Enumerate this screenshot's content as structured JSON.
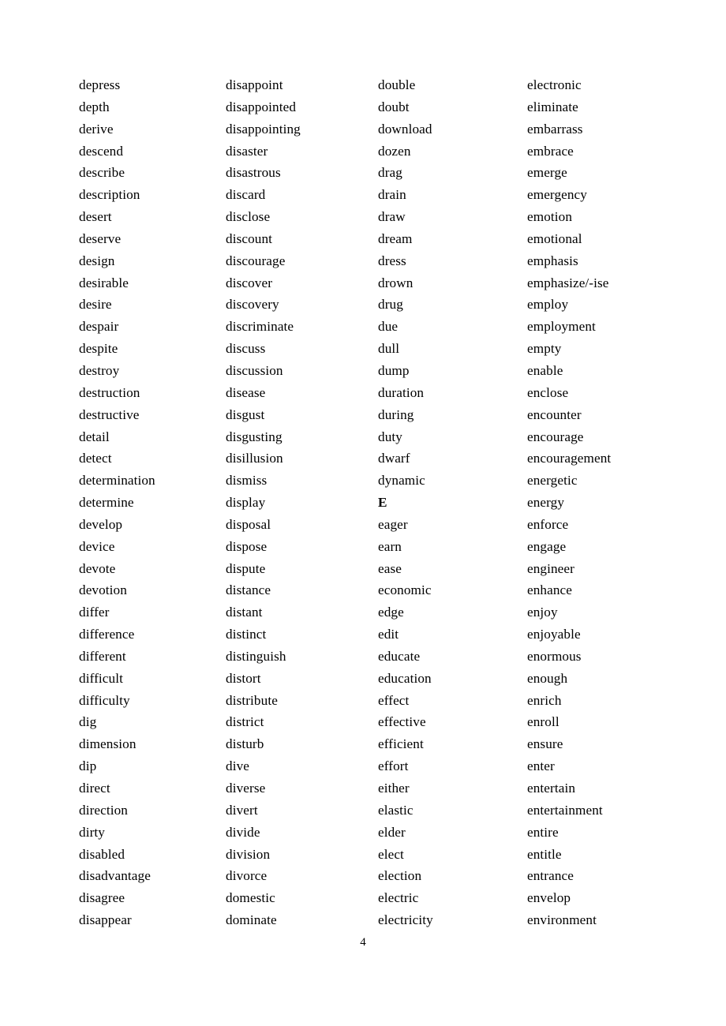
{
  "page": {
    "number": "4",
    "background_color": "#ffffff",
    "text_color": "#000000"
  },
  "columns": [
    {
      "name": "column-1",
      "entries": [
        {
          "text": "depress",
          "bold": false
        },
        {
          "text": "depth",
          "bold": false
        },
        {
          "text": "derive",
          "bold": false
        },
        {
          "text": "descend",
          "bold": false
        },
        {
          "text": "describe",
          "bold": false
        },
        {
          "text": "description",
          "bold": false
        },
        {
          "text": "desert",
          "bold": false
        },
        {
          "text": "deserve",
          "bold": false
        },
        {
          "text": "design",
          "bold": false
        },
        {
          "text": "desirable",
          "bold": false
        },
        {
          "text": "desire",
          "bold": false
        },
        {
          "text": "despair",
          "bold": false
        },
        {
          "text": "despite",
          "bold": false
        },
        {
          "text": "destroy",
          "bold": false
        },
        {
          "text": "destruction",
          "bold": false
        },
        {
          "text": "destructive",
          "bold": false
        },
        {
          "text": "detail",
          "bold": false
        },
        {
          "text": "detect",
          "bold": false
        },
        {
          "text": "determination",
          "bold": false
        },
        {
          "text": "determine",
          "bold": false
        },
        {
          "text": "develop",
          "bold": false
        },
        {
          "text": "device",
          "bold": false
        },
        {
          "text": "devote",
          "bold": false
        },
        {
          "text": "devotion",
          "bold": false
        },
        {
          "text": "differ",
          "bold": false
        },
        {
          "text": "difference",
          "bold": false
        },
        {
          "text": "different",
          "bold": false
        },
        {
          "text": "difficult",
          "bold": false
        },
        {
          "text": "difficulty",
          "bold": false
        },
        {
          "text": "dig",
          "bold": false
        },
        {
          "text": "dimension",
          "bold": false
        },
        {
          "text": "dip",
          "bold": false
        },
        {
          "text": "direct",
          "bold": false
        },
        {
          "text": "direction",
          "bold": false
        },
        {
          "text": "dirty",
          "bold": false
        },
        {
          "text": "disabled",
          "bold": false
        },
        {
          "text": "disadvantage",
          "bold": false
        },
        {
          "text": "disagree",
          "bold": false
        },
        {
          "text": "disappear",
          "bold": false
        }
      ]
    },
    {
      "name": "column-2",
      "entries": [
        {
          "text": "disappoint",
          "bold": false
        },
        {
          "text": "disappointed",
          "bold": false
        },
        {
          "text": "disappointing",
          "bold": false
        },
        {
          "text": "disaster",
          "bold": false
        },
        {
          "text": "disastrous",
          "bold": false
        },
        {
          "text": "discard",
          "bold": false
        },
        {
          "text": "disclose",
          "bold": false
        },
        {
          "text": "discount",
          "bold": false
        },
        {
          "text": "discourage",
          "bold": false
        },
        {
          "text": "discover",
          "bold": false
        },
        {
          "text": "discovery",
          "bold": false
        },
        {
          "text": "discriminate",
          "bold": false
        },
        {
          "text": "discuss",
          "bold": false
        },
        {
          "text": "discussion",
          "bold": false
        },
        {
          "text": "disease",
          "bold": false
        },
        {
          "text": "disgust",
          "bold": false
        },
        {
          "text": "disgusting",
          "bold": false
        },
        {
          "text": "disillusion",
          "bold": false
        },
        {
          "text": "dismiss",
          "bold": false
        },
        {
          "text": "display",
          "bold": false
        },
        {
          "text": "disposal",
          "bold": false
        },
        {
          "text": "dispose",
          "bold": false
        },
        {
          "text": "dispute",
          "bold": false
        },
        {
          "text": "distance",
          "bold": false
        },
        {
          "text": "distant",
          "bold": false
        },
        {
          "text": "distinct",
          "bold": false
        },
        {
          "text": "distinguish",
          "bold": false
        },
        {
          "text": "distort",
          "bold": false
        },
        {
          "text": "distribute",
          "bold": false
        },
        {
          "text": "district",
          "bold": false
        },
        {
          "text": "disturb",
          "bold": false
        },
        {
          "text": "dive",
          "bold": false
        },
        {
          "text": "diverse",
          "bold": false
        },
        {
          "text": "divert",
          "bold": false
        },
        {
          "text": "divide",
          "bold": false
        },
        {
          "text": "division",
          "bold": false
        },
        {
          "text": "divorce",
          "bold": false
        },
        {
          "text": "domestic",
          "bold": false
        },
        {
          "text": "dominate",
          "bold": false
        }
      ]
    },
    {
      "name": "column-3",
      "entries": [
        {
          "text": "double",
          "bold": false
        },
        {
          "text": "doubt",
          "bold": false
        },
        {
          "text": "download",
          "bold": false
        },
        {
          "text": "dozen",
          "bold": false
        },
        {
          "text": "drag",
          "bold": false
        },
        {
          "text": "drain",
          "bold": false
        },
        {
          "text": "draw",
          "bold": false
        },
        {
          "text": "dream",
          "bold": false
        },
        {
          "text": "dress",
          "bold": false
        },
        {
          "text": "drown",
          "bold": false
        },
        {
          "text": "drug",
          "bold": false
        },
        {
          "text": "due",
          "bold": false
        },
        {
          "text": "dull",
          "bold": false
        },
        {
          "text": "dump",
          "bold": false
        },
        {
          "text": "duration",
          "bold": false
        },
        {
          "text": "during",
          "bold": false
        },
        {
          "text": "duty",
          "bold": false
        },
        {
          "text": "dwarf",
          "bold": false
        },
        {
          "text": "dynamic",
          "bold": false
        },
        {
          "text": "E",
          "bold": true
        },
        {
          "text": "eager",
          "bold": false
        },
        {
          "text": "earn",
          "bold": false
        },
        {
          "text": "ease",
          "bold": false
        },
        {
          "text": "economic",
          "bold": false
        },
        {
          "text": "edge",
          "bold": false
        },
        {
          "text": "edit",
          "bold": false
        },
        {
          "text": "educate",
          "bold": false
        },
        {
          "text": "education",
          "bold": false
        },
        {
          "text": "effect",
          "bold": false
        },
        {
          "text": "effective",
          "bold": false
        },
        {
          "text": "efficient",
          "bold": false
        },
        {
          "text": "effort",
          "bold": false
        },
        {
          "text": "either",
          "bold": false
        },
        {
          "text": "elastic",
          "bold": false
        },
        {
          "text": "elder",
          "bold": false
        },
        {
          "text": "elect",
          "bold": false
        },
        {
          "text": "election",
          "bold": false
        },
        {
          "text": "electric",
          "bold": false
        },
        {
          "text": "electricity",
          "bold": false
        }
      ]
    },
    {
      "name": "column-4",
      "entries": [
        {
          "text": "electronic",
          "bold": false
        },
        {
          "text": "eliminate",
          "bold": false
        },
        {
          "text": "embarrass",
          "bold": false
        },
        {
          "text": "embrace",
          "bold": false
        },
        {
          "text": "emerge",
          "bold": false
        },
        {
          "text": "emergency",
          "bold": false
        },
        {
          "text": "emotion",
          "bold": false
        },
        {
          "text": "emotional",
          "bold": false
        },
        {
          "text": "emphasis",
          "bold": false
        },
        {
          "text": "emphasize/-ise",
          "bold": false
        },
        {
          "text": "employ",
          "bold": false
        },
        {
          "text": "employment",
          "bold": false
        },
        {
          "text": "empty",
          "bold": false
        },
        {
          "text": "enable",
          "bold": false
        },
        {
          "text": "enclose",
          "bold": false
        },
        {
          "text": "encounter",
          "bold": false
        },
        {
          "text": "encourage",
          "bold": false
        },
        {
          "text": "encouragement",
          "bold": false
        },
        {
          "text": "energetic",
          "bold": false
        },
        {
          "text": "energy",
          "bold": false
        },
        {
          "text": "enforce",
          "bold": false
        },
        {
          "text": "engage",
          "bold": false
        },
        {
          "text": "engineer",
          "bold": false
        },
        {
          "text": "enhance",
          "bold": false
        },
        {
          "text": "enjoy",
          "bold": false
        },
        {
          "text": "enjoyable",
          "bold": false
        },
        {
          "text": "enormous",
          "bold": false
        },
        {
          "text": "enough",
          "bold": false
        },
        {
          "text": "enrich",
          "bold": false
        },
        {
          "text": "enroll",
          "bold": false
        },
        {
          "text": "ensure",
          "bold": false
        },
        {
          "text": "enter",
          "bold": false
        },
        {
          "text": "entertain",
          "bold": false
        },
        {
          "text": "entertainment",
          "bold": false
        },
        {
          "text": "entire",
          "bold": false
        },
        {
          "text": "entitle",
          "bold": false
        },
        {
          "text": "entrance",
          "bold": false
        },
        {
          "text": "envelop",
          "bold": false
        },
        {
          "text": "environment",
          "bold": false
        }
      ]
    }
  ]
}
